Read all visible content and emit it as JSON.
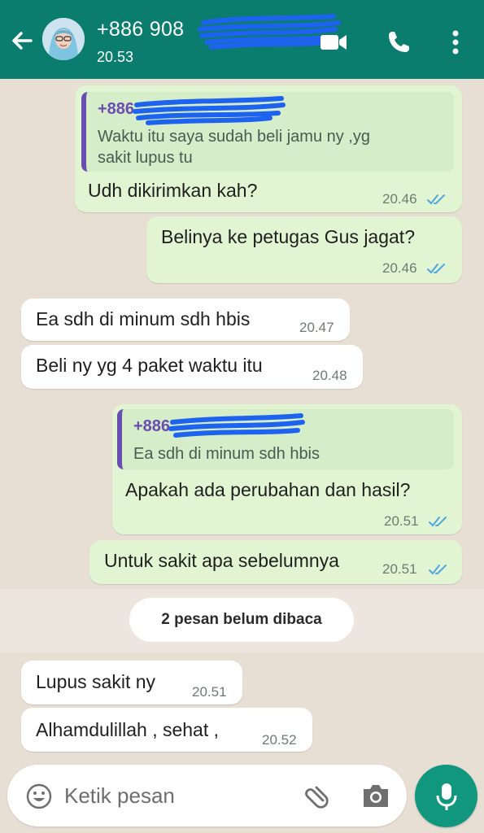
{
  "header": {
    "contact_name": "+886 908",
    "status_time": "20.53",
    "icons": [
      "back-arrow-icon",
      "avatar",
      "video-call-icon",
      "phone-call-icon",
      "more-vert-icon"
    ]
  },
  "messages": [
    {
      "direction": "outgoing",
      "quote_sender": "+886",
      "quote_lines": [
        "Waktu itu saya sudah beli jamu ny ,yg",
        "sakit lupus tu"
      ],
      "text": "Udh dikirimkan kah?",
      "time": "20.46",
      "status": "read"
    },
    {
      "direction": "outgoing",
      "text": "Belinya ke petugas Gus jagat?",
      "time": "20.46",
      "status": "read"
    },
    {
      "direction": "incoming",
      "text": "Ea sdh di minum sdh hbis",
      "time": "20.47"
    },
    {
      "direction": "incoming",
      "text": "Beli ny yg 4 paket waktu itu",
      "time": "20.48"
    },
    {
      "direction": "outgoing",
      "quote_sender": "+886",
      "quote_lines": [
        "Ea sdh di minum sdh hbis"
      ],
      "text": "Apakah ada perubahan dan hasil?",
      "time": "20.51",
      "status": "read"
    },
    {
      "direction": "outgoing",
      "text": "Untuk sakit apa sebelumnya",
      "time": "20.51",
      "status": "read"
    },
    {
      "direction": "incoming",
      "text": "Lupus sakit ny",
      "time": "20.51"
    },
    {
      "direction": "incoming",
      "text": "Alhamdulillah , sehat ,",
      "time": "20.52"
    }
  ],
  "unread_banner": "2 pesan belum dibaca",
  "composer": {
    "placeholder": "Ketik pesan",
    "icons": [
      "emoji-icon",
      "attach-icon",
      "camera-icon",
      "mic-icon"
    ]
  },
  "colors": {
    "header": "#0b7d6e",
    "outgoing_bubble": "#e1f5d3",
    "incoming_bubble": "#ffffff",
    "chat_background": "#e7ded4",
    "read_ticks": "#4fa6e0",
    "quote_accent": "#6a4db0",
    "mic_button": "#11977e",
    "redaction": "#1e63f0"
  }
}
